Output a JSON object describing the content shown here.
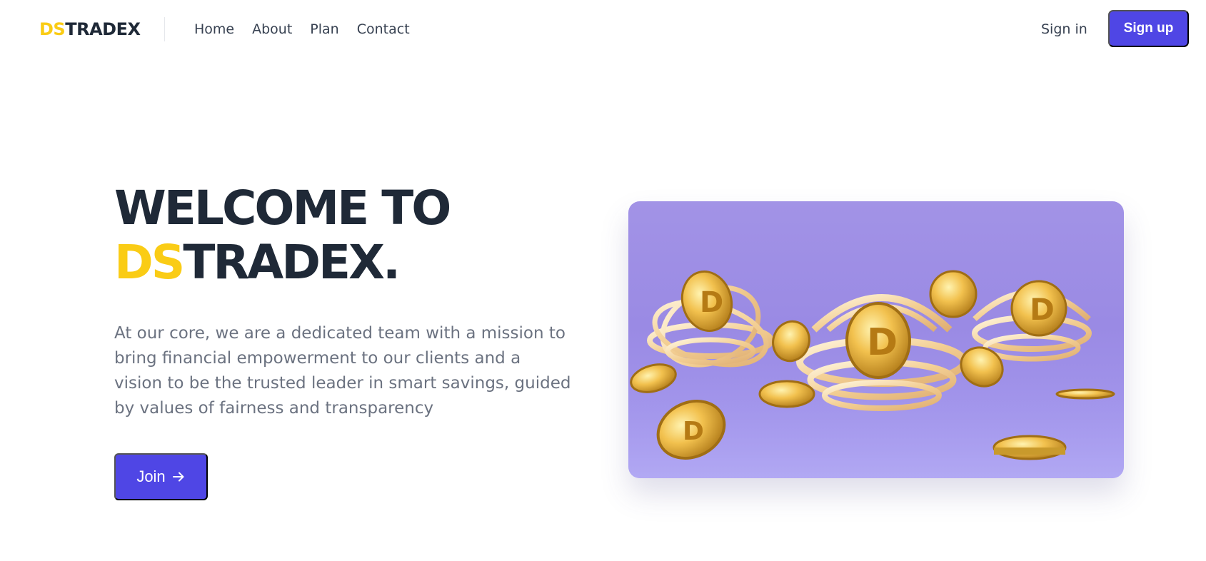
{
  "header": {
    "logo_accent": "DS",
    "logo_rest": "TRADEX",
    "nav": [
      {
        "label": "Home"
      },
      {
        "label": "About"
      },
      {
        "label": "Plan"
      },
      {
        "label": "Contact"
      }
    ],
    "signin_label": "Sign in",
    "signup_label": "Sign up"
  },
  "hero": {
    "title_line1": "WELCOME TO",
    "title_accent": "DS",
    "title_rest": "TRADEX.",
    "description": "At our core, we are a dedicated team with a mission to bring financial empowerment to our clients and a vision to be the trusted leader in smart savings, guided by values of fairness and transparency",
    "join_label": "Join",
    "join_icon": "arrow-right-icon",
    "image_icon": "coins-illustration"
  },
  "colors": {
    "accent": "#facc15",
    "primary": "#4f46e5",
    "heading": "#1f2937",
    "body_text": "#6b7280",
    "card_bg": "#9a8ae4"
  }
}
